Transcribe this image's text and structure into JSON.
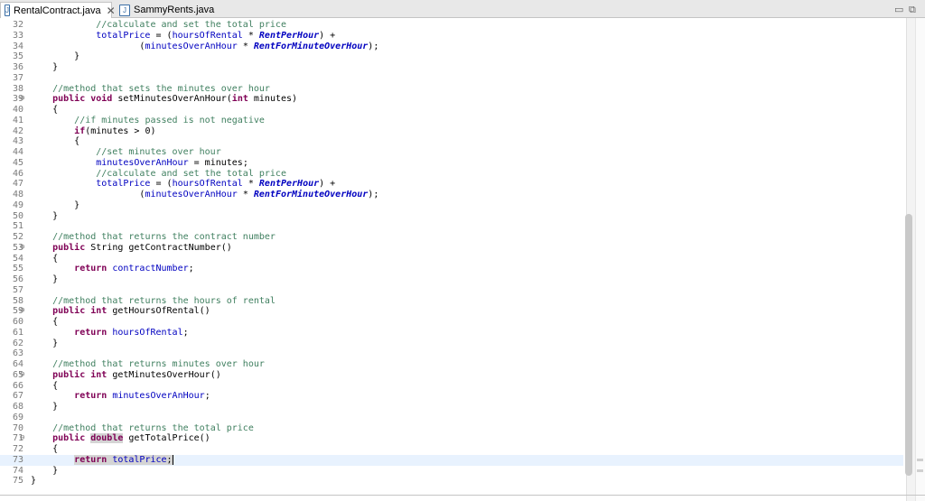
{
  "tabs": [
    {
      "label": "RentalContract.java",
      "icon": "java-file-icon",
      "active": true,
      "close": "✕"
    },
    {
      "label": "SammyRents.java",
      "icon": "java-file-icon",
      "active": false
    }
  ],
  "window_controls": {
    "minimize": "▭",
    "maximize": "⧉"
  },
  "code_lines": [
    {
      "n": "32",
      "segs": [
        [
          "",
          "            "
        ],
        [
          "cm",
          "//calculate and set the total price"
        ]
      ]
    },
    {
      "n": "33",
      "segs": [
        [
          "",
          "            "
        ],
        [
          "fd",
          "totalPrice"
        ],
        [
          "",
          " = ("
        ],
        [
          "fd",
          "hoursOfRental"
        ],
        [
          "",
          " * "
        ],
        [
          "sf",
          "RentPerHour"
        ],
        [
          "",
          ") +"
        ]
      ]
    },
    {
      "n": "34",
      "segs": [
        [
          "",
          "                    ("
        ],
        [
          "fd",
          "minutesOverAnHour"
        ],
        [
          "",
          " * "
        ],
        [
          "sf",
          "RentForMinuteOverHour"
        ],
        [
          "",
          ");"
        ]
      ]
    },
    {
      "n": "35",
      "segs": [
        [
          "",
          "        }"
        ]
      ]
    },
    {
      "n": "36",
      "segs": [
        [
          "",
          "    }"
        ]
      ]
    },
    {
      "n": "37",
      "segs": [
        [
          "",
          ""
        ]
      ]
    },
    {
      "n": "38",
      "segs": [
        [
          "",
          "    "
        ],
        [
          "cm",
          "//method that sets the minutes over hour"
        ]
      ]
    },
    {
      "n": "39",
      "fold": true,
      "segs": [
        [
          "",
          "    "
        ],
        [
          "kw",
          "public"
        ],
        [
          "",
          " "
        ],
        [
          "kw",
          "void"
        ],
        [
          "",
          " setMinutesOverAnHour("
        ],
        [
          "kw",
          "int"
        ],
        [
          "",
          " minutes)"
        ]
      ]
    },
    {
      "n": "40",
      "segs": [
        [
          "",
          "    {"
        ]
      ]
    },
    {
      "n": "41",
      "segs": [
        [
          "",
          "        "
        ],
        [
          "cm",
          "//if minutes passed is not negative"
        ]
      ]
    },
    {
      "n": "42",
      "segs": [
        [
          "",
          "        "
        ],
        [
          "kw",
          "if"
        ],
        [
          "",
          "(minutes > 0)"
        ]
      ]
    },
    {
      "n": "43",
      "segs": [
        [
          "",
          "        {"
        ]
      ]
    },
    {
      "n": "44",
      "segs": [
        [
          "",
          "            "
        ],
        [
          "cm",
          "//set minutes over hour"
        ]
      ]
    },
    {
      "n": "45",
      "segs": [
        [
          "",
          "            "
        ],
        [
          "fd",
          "minutesOverAnHour"
        ],
        [
          "",
          " = minutes;"
        ]
      ]
    },
    {
      "n": "46",
      "segs": [
        [
          "",
          "            "
        ],
        [
          "cm",
          "//calculate and set the total price"
        ]
      ]
    },
    {
      "n": "47",
      "segs": [
        [
          "",
          "            "
        ],
        [
          "fd",
          "totalPrice"
        ],
        [
          "",
          " = ("
        ],
        [
          "fd",
          "hoursOfRental"
        ],
        [
          "",
          " * "
        ],
        [
          "sf",
          "RentPerHour"
        ],
        [
          "",
          ") +"
        ]
      ]
    },
    {
      "n": "48",
      "segs": [
        [
          "",
          "                    ("
        ],
        [
          "fd",
          "minutesOverAnHour"
        ],
        [
          "",
          " * "
        ],
        [
          "sf",
          "RentForMinuteOverHour"
        ],
        [
          "",
          ");"
        ]
      ]
    },
    {
      "n": "49",
      "segs": [
        [
          "",
          "        }"
        ]
      ]
    },
    {
      "n": "50",
      "segs": [
        [
          "",
          "    }"
        ]
      ]
    },
    {
      "n": "51",
      "segs": [
        [
          "",
          ""
        ]
      ]
    },
    {
      "n": "52",
      "segs": [
        [
          "",
          "    "
        ],
        [
          "cm",
          "//method that returns the contract number"
        ]
      ]
    },
    {
      "n": "53",
      "fold": true,
      "segs": [
        [
          "",
          "    "
        ],
        [
          "kw",
          "public"
        ],
        [
          "",
          " String getContractNumber()"
        ]
      ]
    },
    {
      "n": "54",
      "segs": [
        [
          "",
          "    {"
        ]
      ]
    },
    {
      "n": "55",
      "segs": [
        [
          "",
          "        "
        ],
        [
          "kw",
          "return"
        ],
        [
          "",
          " "
        ],
        [
          "fd",
          "contractNumber"
        ],
        [
          "",
          ";"
        ]
      ]
    },
    {
      "n": "56",
      "segs": [
        [
          "",
          "    }"
        ]
      ]
    },
    {
      "n": "57",
      "segs": [
        [
          "",
          ""
        ]
      ]
    },
    {
      "n": "58",
      "segs": [
        [
          "",
          "    "
        ],
        [
          "cm",
          "//method that returns the hours of rental"
        ]
      ]
    },
    {
      "n": "59",
      "fold": true,
      "segs": [
        [
          "",
          "    "
        ],
        [
          "kw",
          "public"
        ],
        [
          "",
          " "
        ],
        [
          "kw",
          "int"
        ],
        [
          "",
          " getHoursOfRental()"
        ]
      ]
    },
    {
      "n": "60",
      "segs": [
        [
          "",
          "    {"
        ]
      ]
    },
    {
      "n": "61",
      "segs": [
        [
          "",
          "        "
        ],
        [
          "kw",
          "return"
        ],
        [
          "",
          " "
        ],
        [
          "fd",
          "hoursOfRental"
        ],
        [
          "",
          ";"
        ]
      ]
    },
    {
      "n": "62",
      "segs": [
        [
          "",
          "    }"
        ]
      ]
    },
    {
      "n": "63",
      "segs": [
        [
          "",
          ""
        ]
      ]
    },
    {
      "n": "64",
      "segs": [
        [
          "",
          "    "
        ],
        [
          "cm",
          "//method that returns minutes over hour"
        ]
      ]
    },
    {
      "n": "65",
      "fold": true,
      "segs": [
        [
          "",
          "    "
        ],
        [
          "kw",
          "public"
        ],
        [
          "",
          " "
        ],
        [
          "kw",
          "int"
        ],
        [
          "",
          " getMinutesOverHour()"
        ]
      ]
    },
    {
      "n": "66",
      "segs": [
        [
          "",
          "    {"
        ]
      ]
    },
    {
      "n": "67",
      "segs": [
        [
          "",
          "        "
        ],
        [
          "kw",
          "return"
        ],
        [
          "",
          " "
        ],
        [
          "fd",
          "minutesOverAnHour"
        ],
        [
          "",
          ";"
        ]
      ]
    },
    {
      "n": "68",
      "segs": [
        [
          "",
          "    }"
        ]
      ]
    },
    {
      "n": "69",
      "segs": [
        [
          "",
          ""
        ]
      ]
    },
    {
      "n": "70",
      "segs": [
        [
          "",
          "    "
        ],
        [
          "cm",
          "//method that returns the total price"
        ]
      ]
    },
    {
      "n": "71",
      "fold": true,
      "segs": [
        [
          "",
          "    "
        ],
        [
          "kw",
          "public"
        ],
        [
          "",
          " "
        ],
        [
          "kw hl",
          "double"
        ],
        [
          "",
          " getTotalPrice()"
        ]
      ]
    },
    {
      "n": "72",
      "segs": [
        [
          "",
          "    {"
        ]
      ]
    },
    {
      "n": "73",
      "current": true,
      "segs": [
        [
          "",
          "        "
        ],
        [
          "kw hl",
          "return"
        ],
        [
          "hl",
          " "
        ],
        [
          "fd hl",
          "totalPrice"
        ],
        [
          "hl",
          ";"
        ]
      ]
    },
    {
      "n": "74",
      "segs": [
        [
          "",
          "    }"
        ]
      ]
    },
    {
      "n": "75",
      "segs": [
        [
          "",
          "}"
        ]
      ]
    }
  ]
}
